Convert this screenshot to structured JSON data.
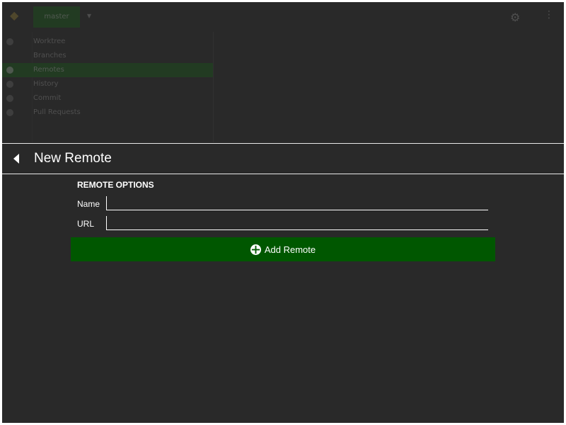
{
  "background": {
    "branch_button_label": "master",
    "nav_items": [
      {
        "label": "Worktree",
        "active": false
      },
      {
        "label": "Branches",
        "active": false
      },
      {
        "label": "Remotes",
        "active": true
      },
      {
        "label": "History",
        "active": false
      },
      {
        "label": "Commit",
        "active": false
      },
      {
        "label": "Pull Requests",
        "active": false
      }
    ]
  },
  "panel": {
    "title": "New Remote",
    "section_title": "REMOTE OPTIONS",
    "fields": {
      "name_label": "Name",
      "name_value": "",
      "url_label": "URL",
      "url_value": ""
    },
    "add_button_label": "Add Remote"
  },
  "colors": {
    "panel_background": "#292929",
    "accent_green": "#005700",
    "text": "#ffffff"
  }
}
